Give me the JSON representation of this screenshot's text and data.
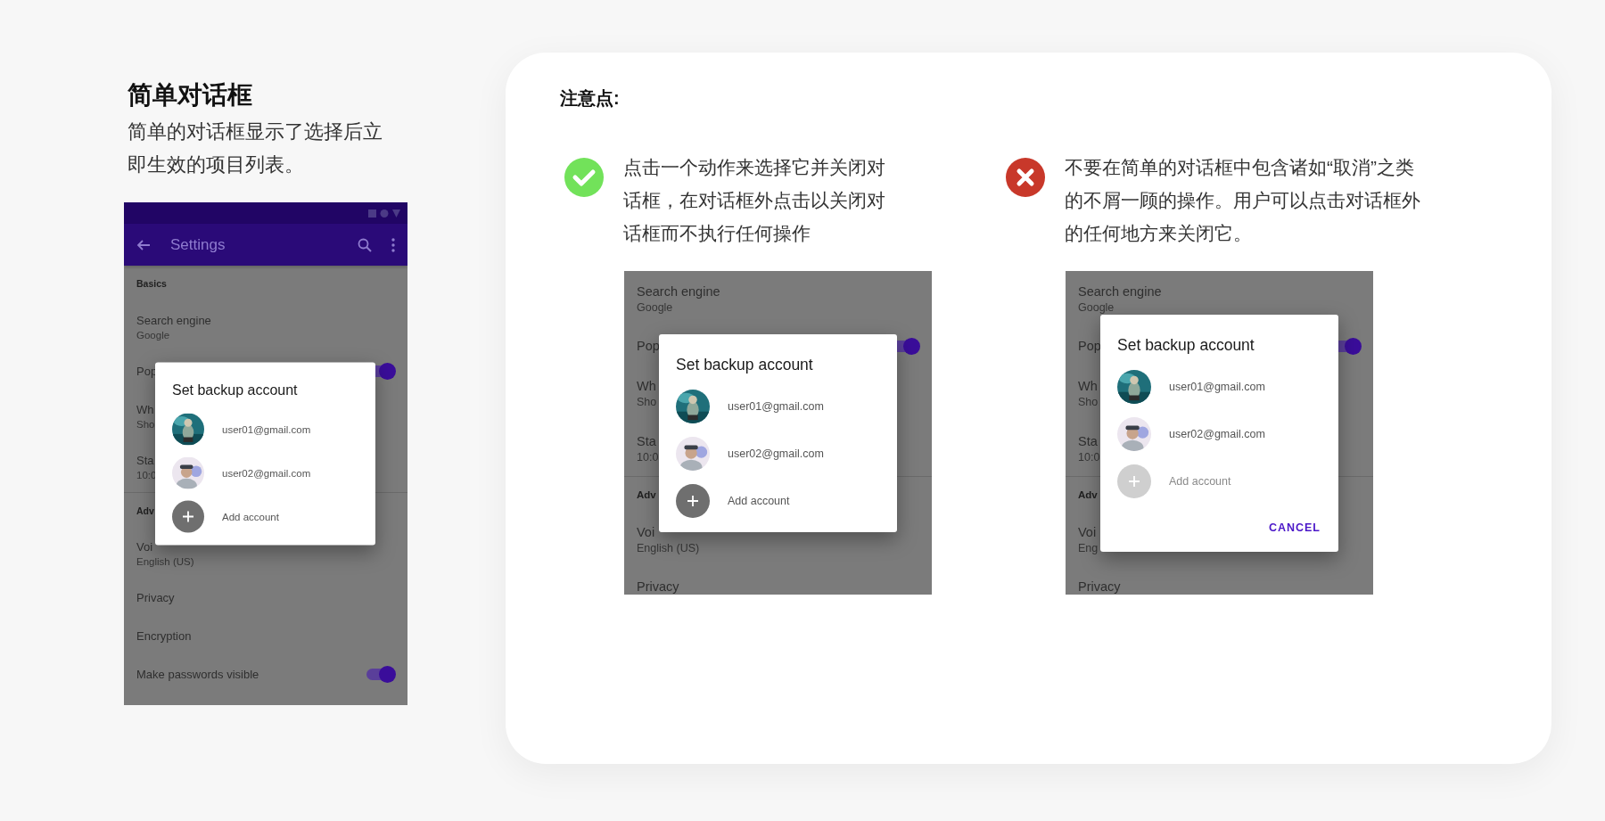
{
  "intro": {
    "title": "简单对话框",
    "description": "简单的对话框显示了选择后立即生效的项目列表。"
  },
  "phone": {
    "app_bar": {
      "title": "Settings"
    },
    "settings": [
      {
        "kind": "header",
        "title": "Basics"
      },
      {
        "kind": "item",
        "title": "Search engine",
        "subtitle": "Google"
      },
      {
        "kind": "toggle",
        "title": "Pop",
        "on": true
      },
      {
        "kind": "item",
        "title": "Wh",
        "subtitle": "Sho"
      },
      {
        "kind": "item",
        "title": "Sta",
        "subtitle": "10:0"
      },
      {
        "kind": "header",
        "title": "Adv"
      },
      {
        "kind": "item",
        "title": "Voi",
        "subtitle": "English (US)"
      },
      {
        "kind": "item",
        "title": "Privacy"
      },
      {
        "kind": "item",
        "title": "Encryption"
      },
      {
        "kind": "toggle",
        "title": "Make passwords visible",
        "on": true
      }
    ],
    "dialog": {
      "title": "Set backup account",
      "accounts": [
        {
          "email": "user01@gmail.com"
        },
        {
          "email": "user02@gmail.com"
        }
      ],
      "add_account": {
        "label": "Add account",
        "disabled": false
      }
    }
  },
  "notes": {
    "title": "注意点:",
    "items": [
      {
        "kind": "do",
        "text": "点击一个动作来选择它并关闭对话框，在对话框外点击以关闭对话框而不执行任何操作",
        "mockup": {
          "settings": [
            {
              "kind": "item",
              "title": "Search engine",
              "subtitle": "Google"
            },
            {
              "kind": "toggle",
              "title": "Pop",
              "on": true
            },
            {
              "kind": "item",
              "title": "Wh",
              "subtitle": "Sho"
            },
            {
              "kind": "item",
              "title": "Sta",
              "subtitle": "10:0"
            },
            {
              "kind": "header",
              "title": "Adv"
            },
            {
              "kind": "item",
              "title": "Voi",
              "subtitle": "English (US)"
            },
            {
              "kind": "item",
              "title": "Privacy"
            }
          ],
          "dialog": {
            "title": "Set backup account",
            "accounts": [
              {
                "email": "user01@gmail.com"
              },
              {
                "email": "user02@gmail.com"
              }
            ],
            "add_account": {
              "label": "Add account",
              "disabled": false
            }
          }
        }
      },
      {
        "kind": "dont",
        "text": "不要在简单的对话框中包含诸如“取消”之类的不屑一顾的操作。用户可以点击对话框外的任何地方来关闭它。",
        "mockup": {
          "settings": [
            {
              "kind": "item",
              "title": "Search engine",
              "subtitle": "Google"
            },
            {
              "kind": "toggle",
              "title": "Pop",
              "on": true
            },
            {
              "kind": "item",
              "title": "Wh",
              "subtitle": "Sho"
            },
            {
              "kind": "item",
              "title": "Sta",
              "subtitle": "10:0"
            },
            {
              "kind": "header",
              "title": "Adv"
            },
            {
              "kind": "item",
              "title": "Voi",
              "subtitle": "Eng"
            },
            {
              "kind": "item",
              "title": "Privacy"
            }
          ],
          "dialog": {
            "title": "Set backup account",
            "accounts": [
              {
                "email": "user01@gmail.com"
              },
              {
                "email": "user02@gmail.com"
              }
            ],
            "add_account": {
              "label": "Add account",
              "disabled": true
            },
            "cancel": "CANCEL"
          }
        }
      }
    ]
  }
}
